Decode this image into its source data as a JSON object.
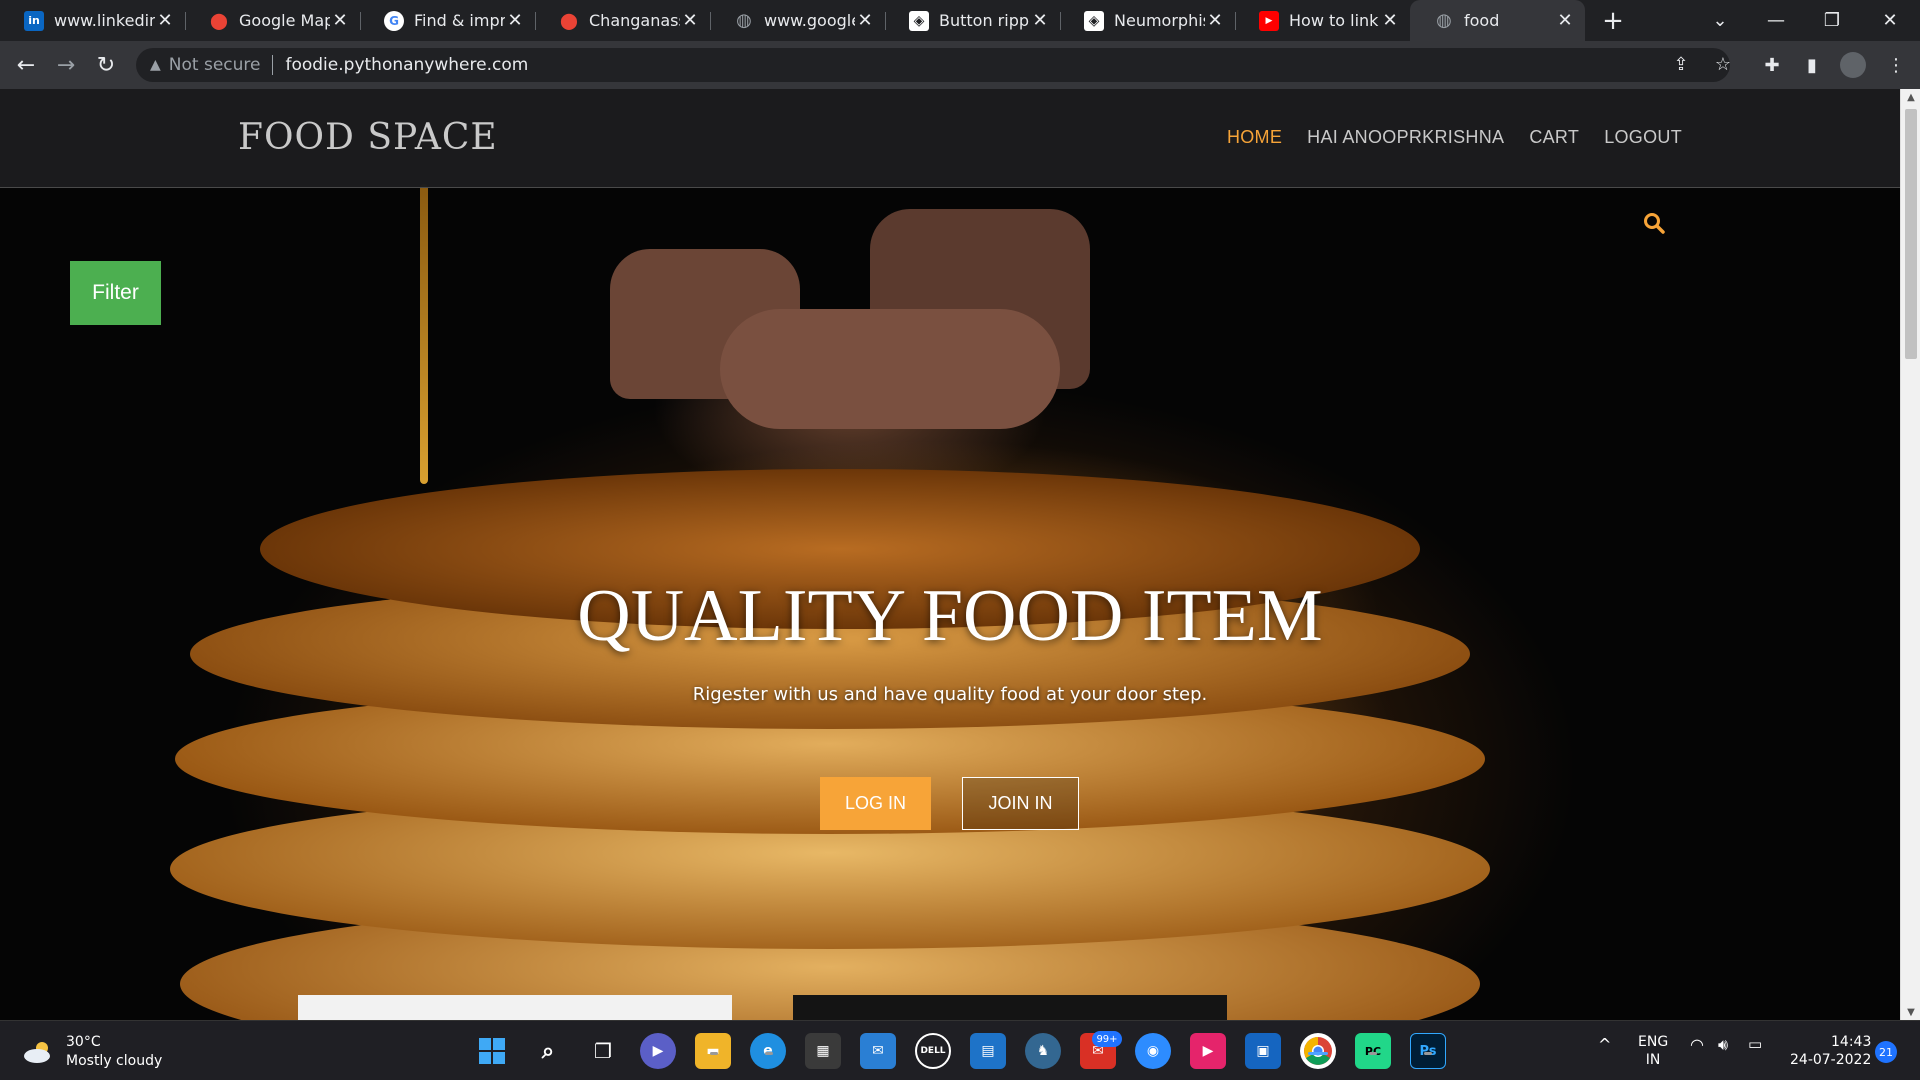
{
  "browser": {
    "tabs": [
      {
        "label": "www.linkedin.c",
        "icon": "linkedin-icon",
        "color": "#0a66c2",
        "glyph": "in"
      },
      {
        "label": "Google Maps",
        "icon": "google-maps-icon",
        "color": "#ea4335",
        "glyph": "⬤"
      },
      {
        "label": "Find & improv",
        "icon": "google-icon",
        "color": "#4285f4",
        "glyph": "G"
      },
      {
        "label": "Changanasser",
        "icon": "google-maps-icon",
        "color": "#ea4335",
        "glyph": "⬤"
      },
      {
        "label": "www.google.c",
        "icon": "globe-icon",
        "color": "#9aa0a6",
        "glyph": "◍"
      },
      {
        "label": "Button ripple",
        "icon": "codepen-icon",
        "color": "#ffffff",
        "glyph": "◈"
      },
      {
        "label": "Neumorphism",
        "icon": "codepen-icon",
        "color": "#ffffff",
        "glyph": "◈"
      },
      {
        "label": "How to link C",
        "icon": "youtube-icon",
        "color": "#ff0000",
        "glyph": "▶"
      },
      {
        "label": "food",
        "icon": "globe-icon",
        "color": "#9aa0a6",
        "glyph": "◍",
        "active": true
      }
    ],
    "security_label": "Not secure",
    "url": "foodie.pythonanywhere.com"
  },
  "site": {
    "brand": "FOOD SPACE",
    "nav": [
      "HOME",
      "HAI ANOOPRKRISHNA",
      "CART",
      "LOGOUT"
    ],
    "filter_label": "Filter",
    "hero_title": "QUALITY FOOD ITEM",
    "hero_subtitle": "Rigester with us and have quality food at your door step.",
    "login_label": "LOG IN",
    "join_label": "JOIN IN",
    "accent_color": "#f7a438",
    "filter_color": "#4caf50"
  },
  "taskbar": {
    "temperature": "30°C",
    "weather": "Mostly cloudy",
    "mail_badge": "99+",
    "lang_top": "ENG",
    "lang_bottom": "IN",
    "time": "14:43",
    "date": "24-07-2022",
    "notif_count": "21"
  }
}
